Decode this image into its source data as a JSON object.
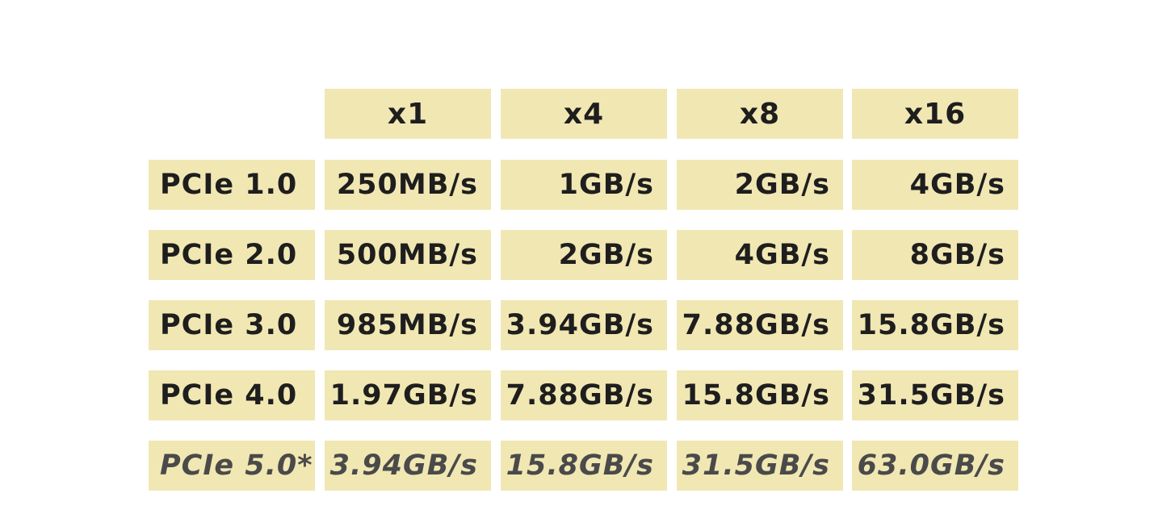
{
  "header": {
    "columns": [
      "x1",
      "x4",
      "x8",
      "x16"
    ]
  },
  "rows": [
    {
      "label": "PCIe 1.0",
      "values": [
        "250MB/s",
        "1GB/s",
        "2GB/s",
        "4GB/s"
      ]
    },
    {
      "label": "PCIe 2.0",
      "values": [
        "500MB/s",
        "2GB/s",
        "4GB/s",
        "8GB/s"
      ]
    },
    {
      "label": "PCIe 3.0",
      "values": [
        "985MB/s",
        "3.94GB/s",
        "7.88GB/s",
        "15.8GB/s"
      ]
    },
    {
      "label": "PCIe 4.0",
      "values": [
        "1.97GB/s",
        "7.88GB/s",
        "15.8GB/s",
        "31.5GB/s"
      ]
    },
    {
      "label": "PCIe 5.0*",
      "values": [
        "3.94GB/s",
        "15.8GB/s",
        "31.5GB/s",
        "63.0GB/s"
      ]
    }
  ],
  "colors": {
    "cell_background": "#f1e7b3",
    "text": "#1e1e1e",
    "italic_text": "#4a4a4a"
  }
}
